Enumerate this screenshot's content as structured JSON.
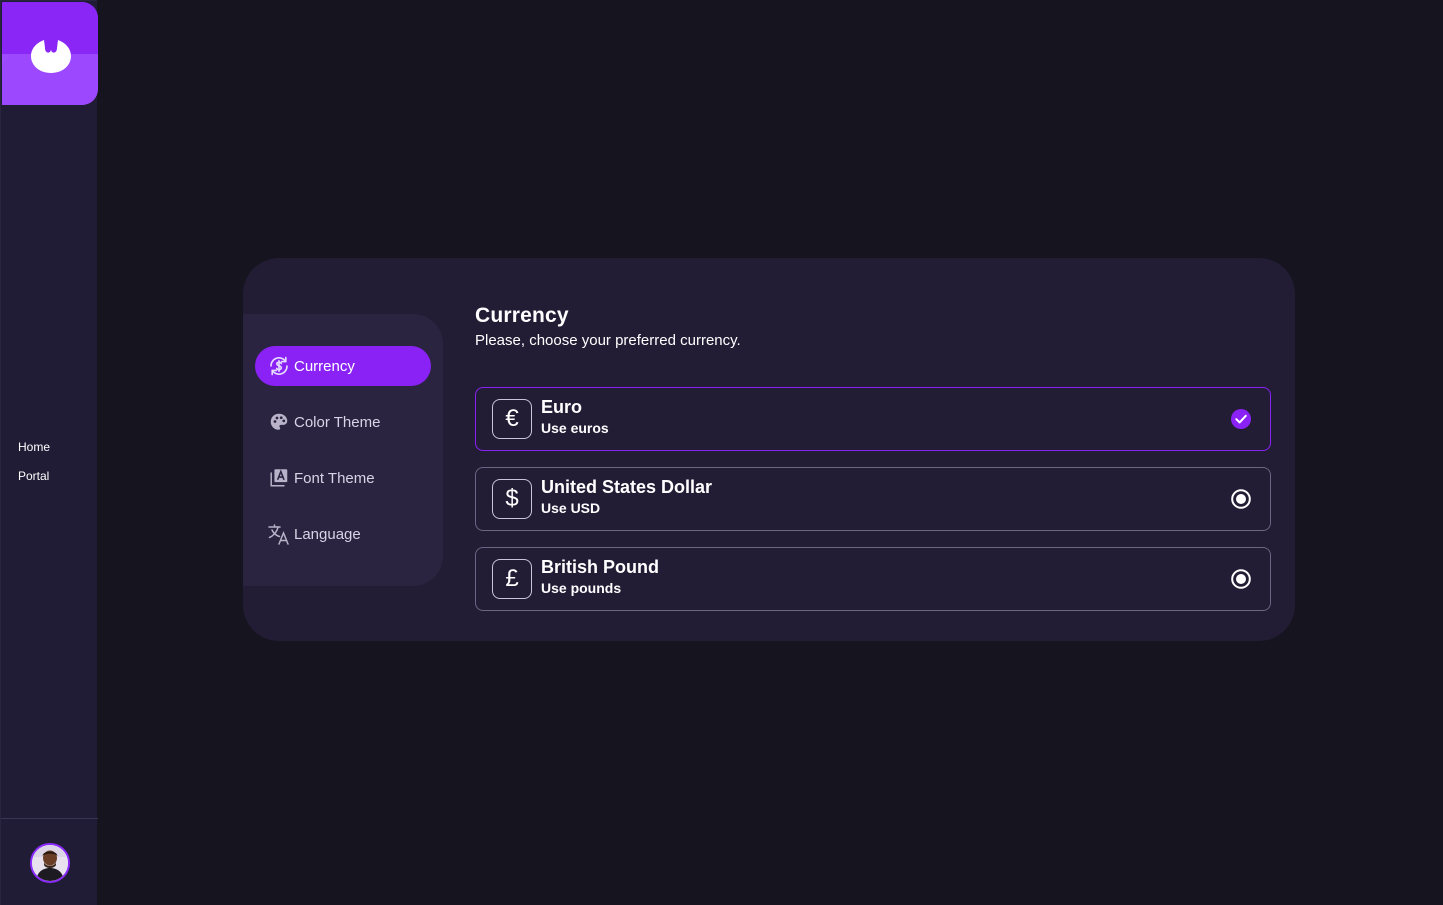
{
  "nav": {
    "links": [
      {
        "label": "Home"
      },
      {
        "label": "Portal"
      }
    ]
  },
  "settings": {
    "menu": [
      {
        "label": "Currency",
        "icon": "currency-exchange-icon",
        "active": true
      },
      {
        "label": "Color Theme",
        "icon": "palette-icon",
        "active": false
      },
      {
        "label": "Font Theme",
        "icon": "font-icon",
        "active": false
      },
      {
        "label": "Language",
        "icon": "translate-icon",
        "active": false
      }
    ],
    "title": "Currency",
    "subtitle": "Please, choose your preferred currency.",
    "options": [
      {
        "symbol": "€",
        "title": "Euro",
        "description": "Use euros",
        "selected": true
      },
      {
        "symbol": "$",
        "title": "United States Dollar",
        "description": "Use USD",
        "selected": false
      },
      {
        "symbol": "£",
        "title": "British Pound",
        "description": "Use pounds",
        "selected": false
      }
    ]
  },
  "colors": {
    "accent": "#8a22f6",
    "background": "#16141f",
    "panel": "#221d35",
    "sidebar": "#211c35"
  }
}
